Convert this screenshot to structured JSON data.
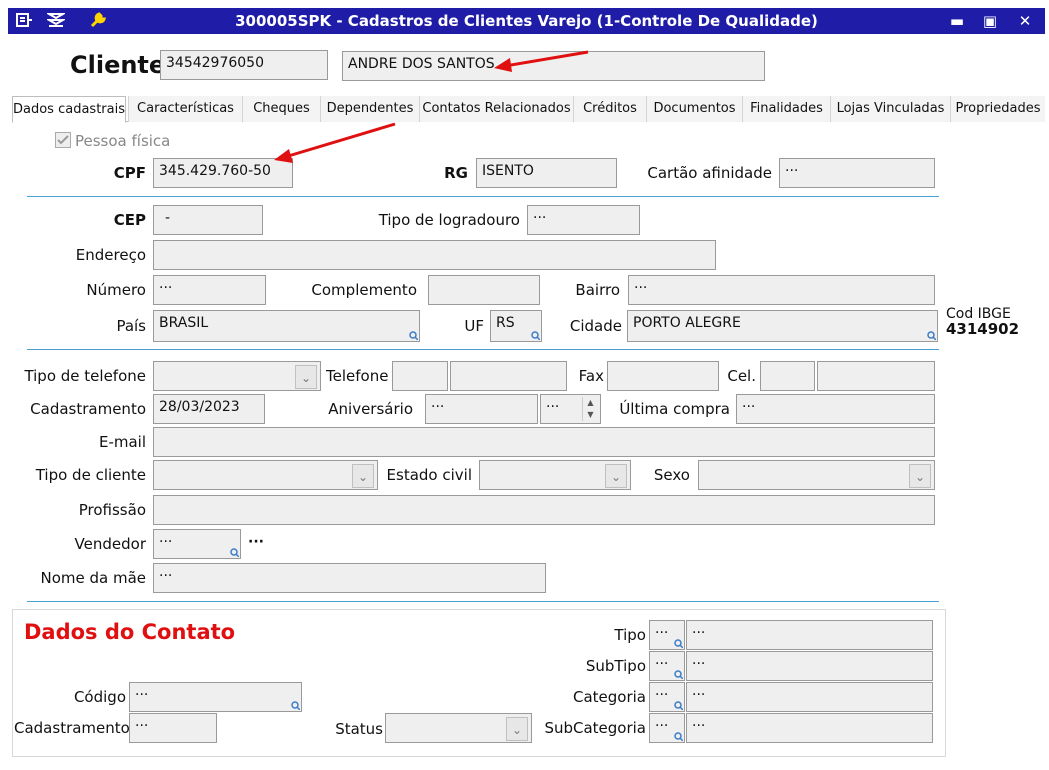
{
  "window": {
    "title": "300005SPK - Cadastros de Clientes Varejo (1-Controle De Qualidade)",
    "minimize_glyph": "▬",
    "maximize_glyph": "▣",
    "close_glyph": "✕"
  },
  "header": {
    "label": "Cliente",
    "code": "34542976050",
    "name": "ANDRE DOS SANTOS"
  },
  "tabs": [
    {
      "label": "Dados cadastrais",
      "active": true
    },
    {
      "label": "Características"
    },
    {
      "label": "Cheques"
    },
    {
      "label": "Dependentes"
    },
    {
      "label": "Contatos Relacionados"
    },
    {
      "label": "Créditos"
    },
    {
      "label": "Documentos"
    },
    {
      "label": "Finalidades"
    },
    {
      "label": "Lojas Vinculadas"
    },
    {
      "label": "Propriedades"
    }
  ],
  "pessoa_fisica": {
    "label": "Pessoa física",
    "checked": true
  },
  "identity": {
    "cpf_label": "CPF",
    "cpf_value": "345.429.760-50",
    "rg_label": "RG",
    "rg_value": "ISENTO",
    "cartao_label": "Cartão afinidade",
    "cartao_value": "···"
  },
  "address": {
    "cep_label": "CEP",
    "cep_value": "-",
    "tipo_logradouro_label": "Tipo de logradouro",
    "tipo_logradouro_value": "···",
    "endereco_label": "Endereço",
    "endereco_value": "",
    "numero_label": "Número",
    "numero_value": "···",
    "complemento_label": "Complemento",
    "complemento_value": "",
    "bairro_label": "Bairro",
    "bairro_value": "···",
    "pais_label": "País",
    "pais_value": "BRASIL",
    "uf_label": "UF",
    "uf_value": "RS",
    "cidade_label": "Cidade",
    "cidade_value": "PORTO ALEGRE",
    "ibge_label": "Cod IBGE",
    "ibge_value": "4314902"
  },
  "contact": {
    "tipo_telefone_label": "Tipo de telefone",
    "telefone_label": "Telefone",
    "fax_label": "Fax",
    "cel_label": "Cel.",
    "cadastramento_label": "Cadastramento",
    "cadastramento_value": "28/03/2023",
    "aniversario_label": "Aniversário",
    "aniversario_value": "···",
    "aniversario_day": "···",
    "ultima_compra_label": "Última compra",
    "ultima_compra_value": "···",
    "email_label": "E-mail",
    "tipo_cliente_label": "Tipo de cliente",
    "estado_civil_label": "Estado civil",
    "sexo_label": "Sexo",
    "profissao_label": "Profissão",
    "vendedor_label": "Vendedor",
    "vendedor_value": "···",
    "vendedor_extra": "···",
    "nome_mae_label": "Nome da mãe",
    "nome_mae_value": "···"
  },
  "dados_contato": {
    "heading": "Dados do Contato",
    "codigo_label": "Código",
    "codigo_value": "···",
    "cadastramento_label": "Cadastramento",
    "cadastramento_value": "···",
    "status_label": "Status",
    "tipo_label": "Tipo",
    "tipo_code": "···",
    "tipo_desc": "···",
    "subtipo_label": "SubTipo",
    "subtipo_code": "···",
    "subtipo_desc": "···",
    "categoria_label": "Categoria",
    "categoria_code": "···",
    "categoria_desc": "···",
    "subcategoria_label": "SubCategoria",
    "subcategoria_code": "···",
    "subcategoria_desc": "···"
  },
  "colors": {
    "titlebar": "#1f1ca8",
    "heading_red": "#e01010",
    "separator": "#4a9fd4",
    "annotation_arrow": "#e01010"
  }
}
